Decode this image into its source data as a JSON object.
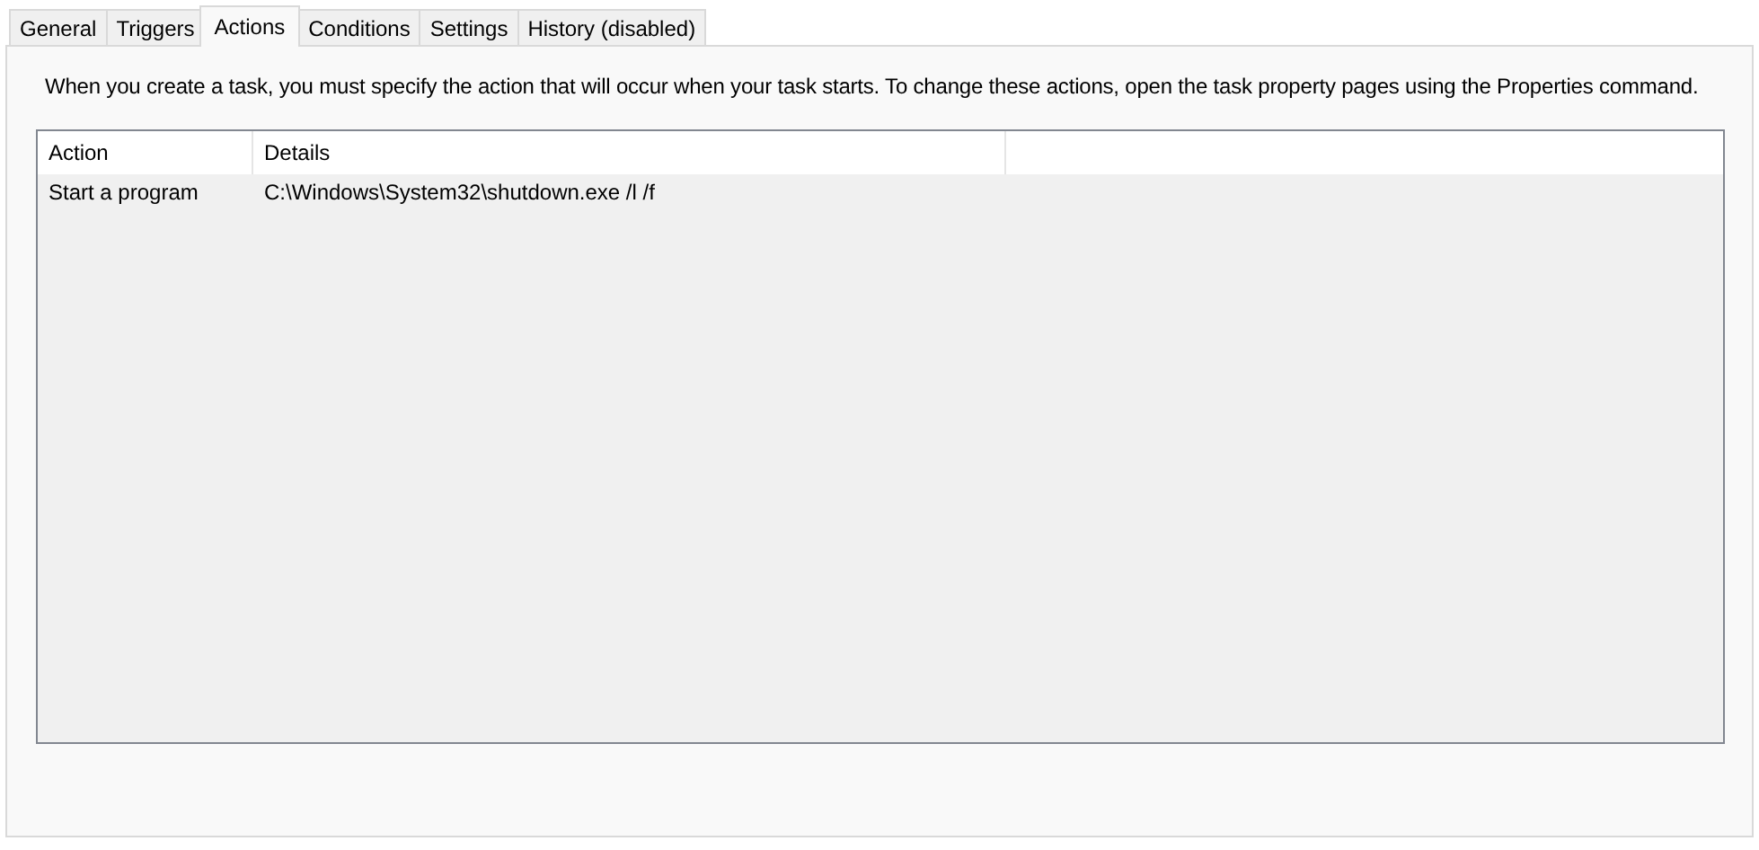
{
  "tabs": [
    {
      "label": "General",
      "selected": false
    },
    {
      "label": "Triggers",
      "selected": false
    },
    {
      "label": "Actions",
      "selected": true
    },
    {
      "label": "Conditions",
      "selected": false
    },
    {
      "label": "Settings",
      "selected": false
    },
    {
      "label": "History (disabled)",
      "selected": false
    }
  ],
  "description": "When you create a task, you must specify the action that will occur when your task starts.  To change these actions, open the task property pages using the Properties command.",
  "table": {
    "columns": [
      "Action",
      "Details"
    ],
    "rows": [
      {
        "cells": [
          "Start a program",
          "C:\\Windows\\System32\\shutdown.exe /l /f"
        ]
      }
    ]
  }
}
